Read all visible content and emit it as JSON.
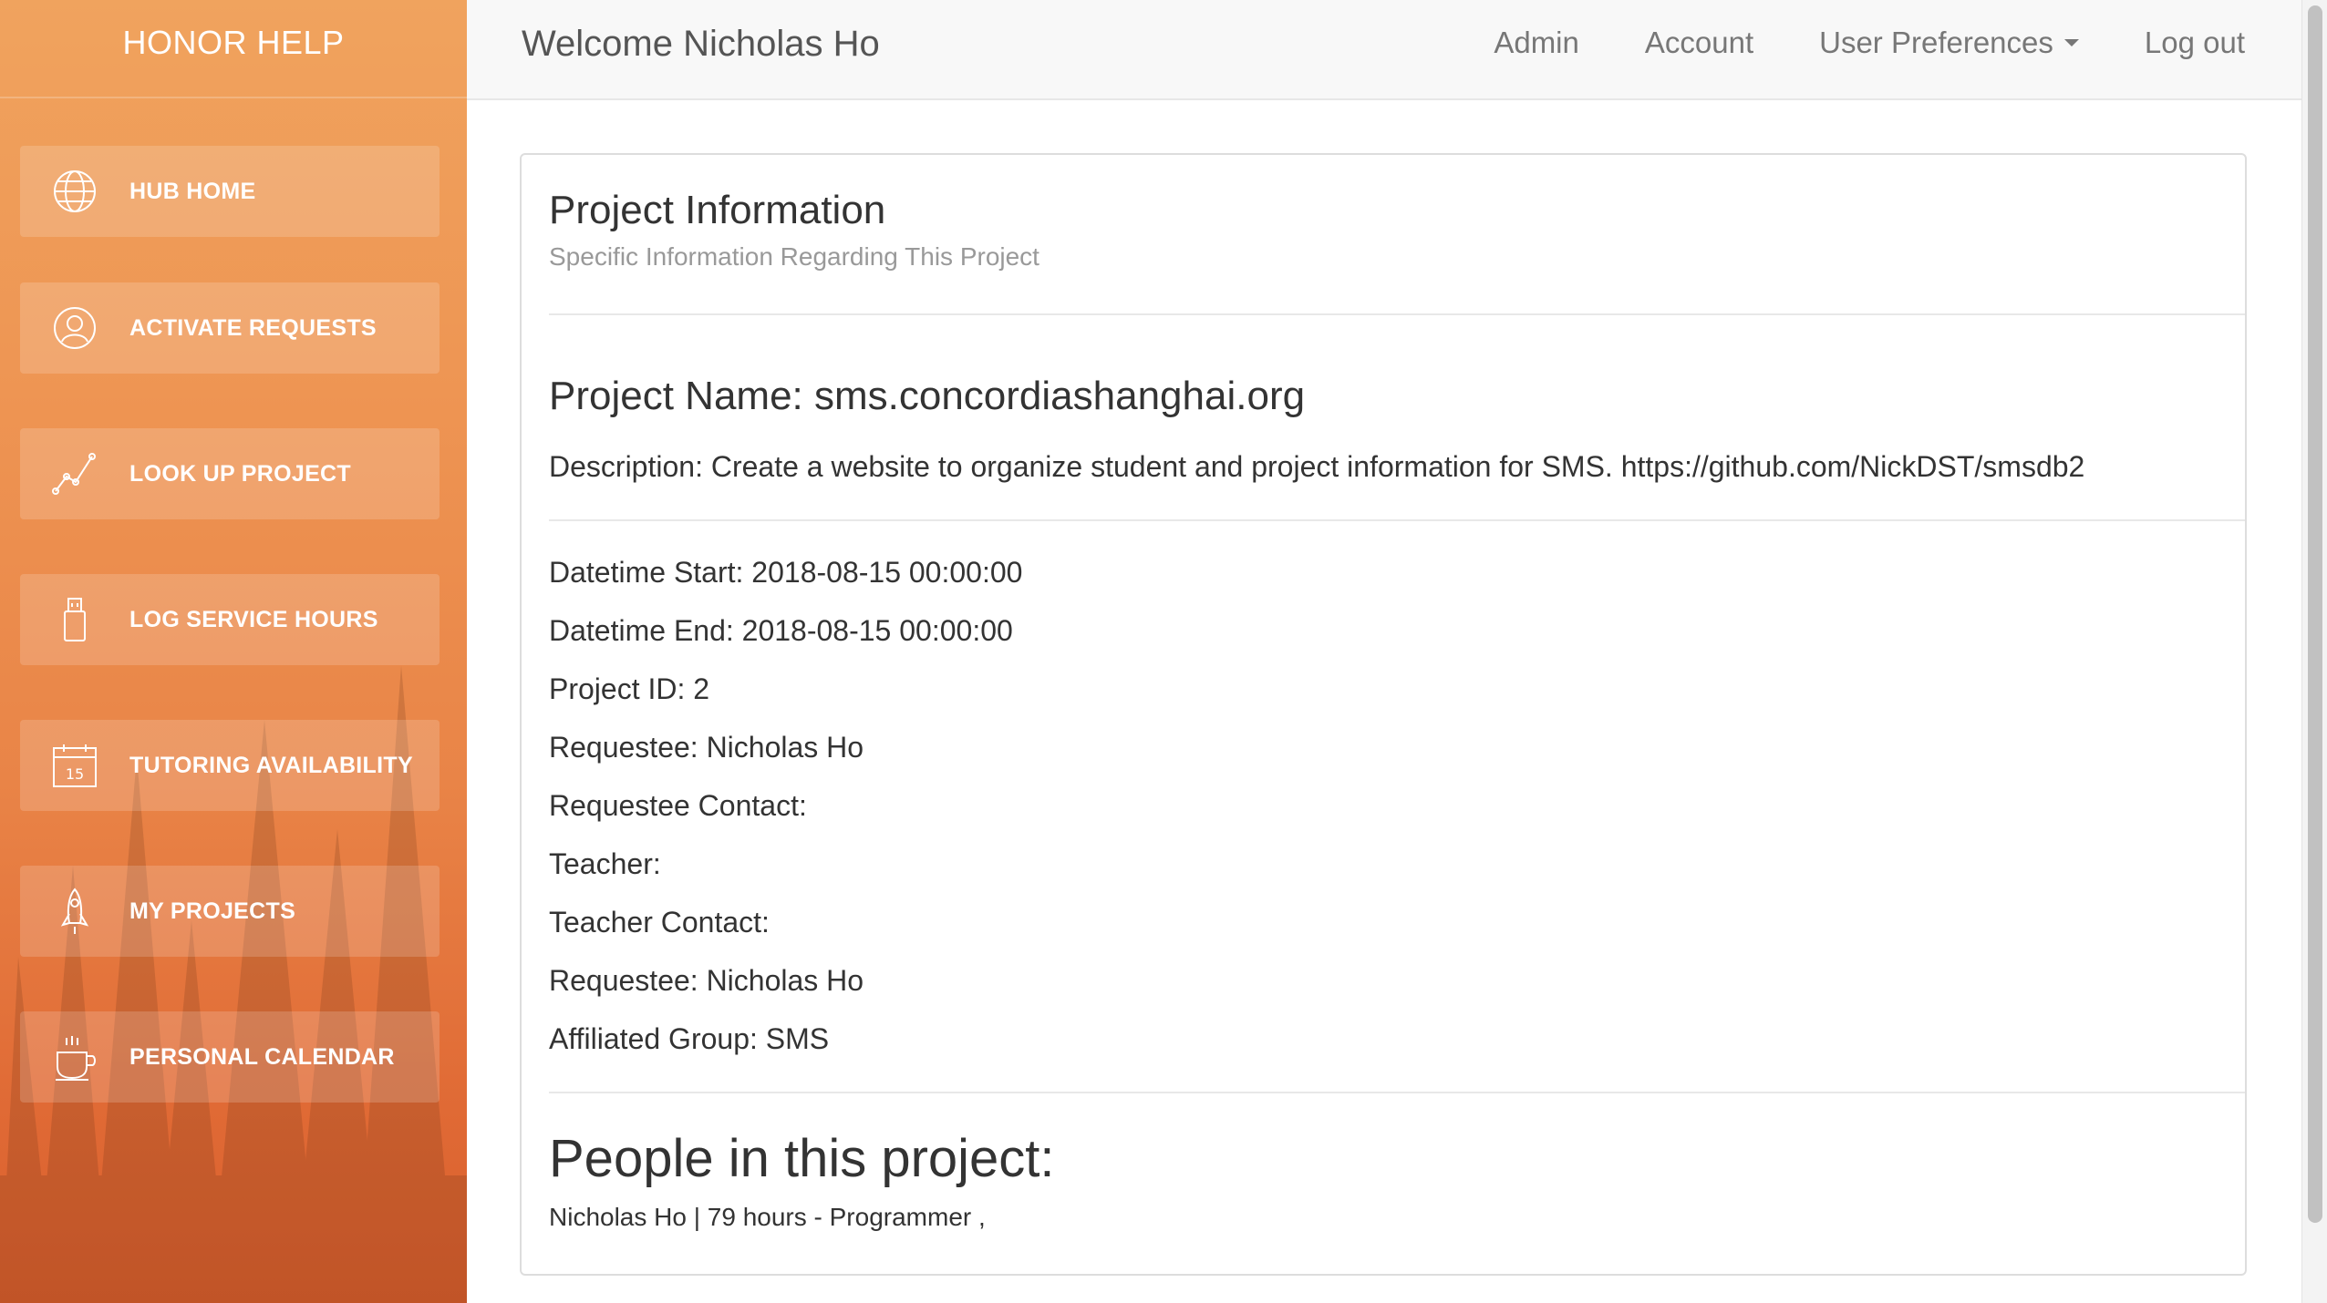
{
  "brand": "HONOR HELP",
  "sidebar": {
    "items": [
      {
        "label": "HUB HOME",
        "icon": "globe-icon"
      },
      {
        "label": "ACTIVATE REQUESTS",
        "icon": "user-icon"
      },
      {
        "label": "LOOK UP PROJECT",
        "icon": "chart-line-icon"
      },
      {
        "label": "LOG SERVICE HOURS",
        "icon": "usb-drive-icon"
      },
      {
        "label": "TUTORING AVAILABILITY",
        "icon": "calendar-icon"
      },
      {
        "label": "MY PROJECTS",
        "icon": "rocket-icon"
      },
      {
        "label": "PERSONAL CALENDAR",
        "icon": "coffee-cup-icon"
      }
    ]
  },
  "topbar": {
    "welcome": "Welcome Nicholas Ho",
    "links": {
      "admin": "Admin",
      "account": "Account",
      "preferences": "User Preferences",
      "logout": "Log out"
    }
  },
  "panel": {
    "title": "Project Information",
    "subtitle": "Specific Information Regarding This Project",
    "project_name": "Project Name: sms.concordiashanghai.org",
    "description": "Description: Create a website to organize student and project information for SMS. https://github.com/NickDST/smsdb2",
    "fields": {
      "datetime_start": "Datetime Start: 2018-08-15 00:00:00",
      "datetime_end": "Datetime End: 2018-08-15 00:00:00",
      "project_id": "Project ID: 2",
      "requestee": "Requestee: Nicholas Ho",
      "requestee_contact": "Requestee Contact:",
      "teacher": "Teacher:",
      "teacher_contact": "Teacher Contact:",
      "requestee_repeat": "Requestee: Nicholas Ho",
      "affiliated_group": "Affiliated Group: SMS"
    },
    "people_title": "People in this project:",
    "people": "Nicholas Ho | 79 hours - Programmer ,"
  },
  "colors": {
    "sidebar_top": "#f0a35e",
    "sidebar_bottom": "#d95e2d",
    "topbar_bg": "#f8f8f8",
    "text_main": "#333333",
    "text_muted": "#999999"
  }
}
